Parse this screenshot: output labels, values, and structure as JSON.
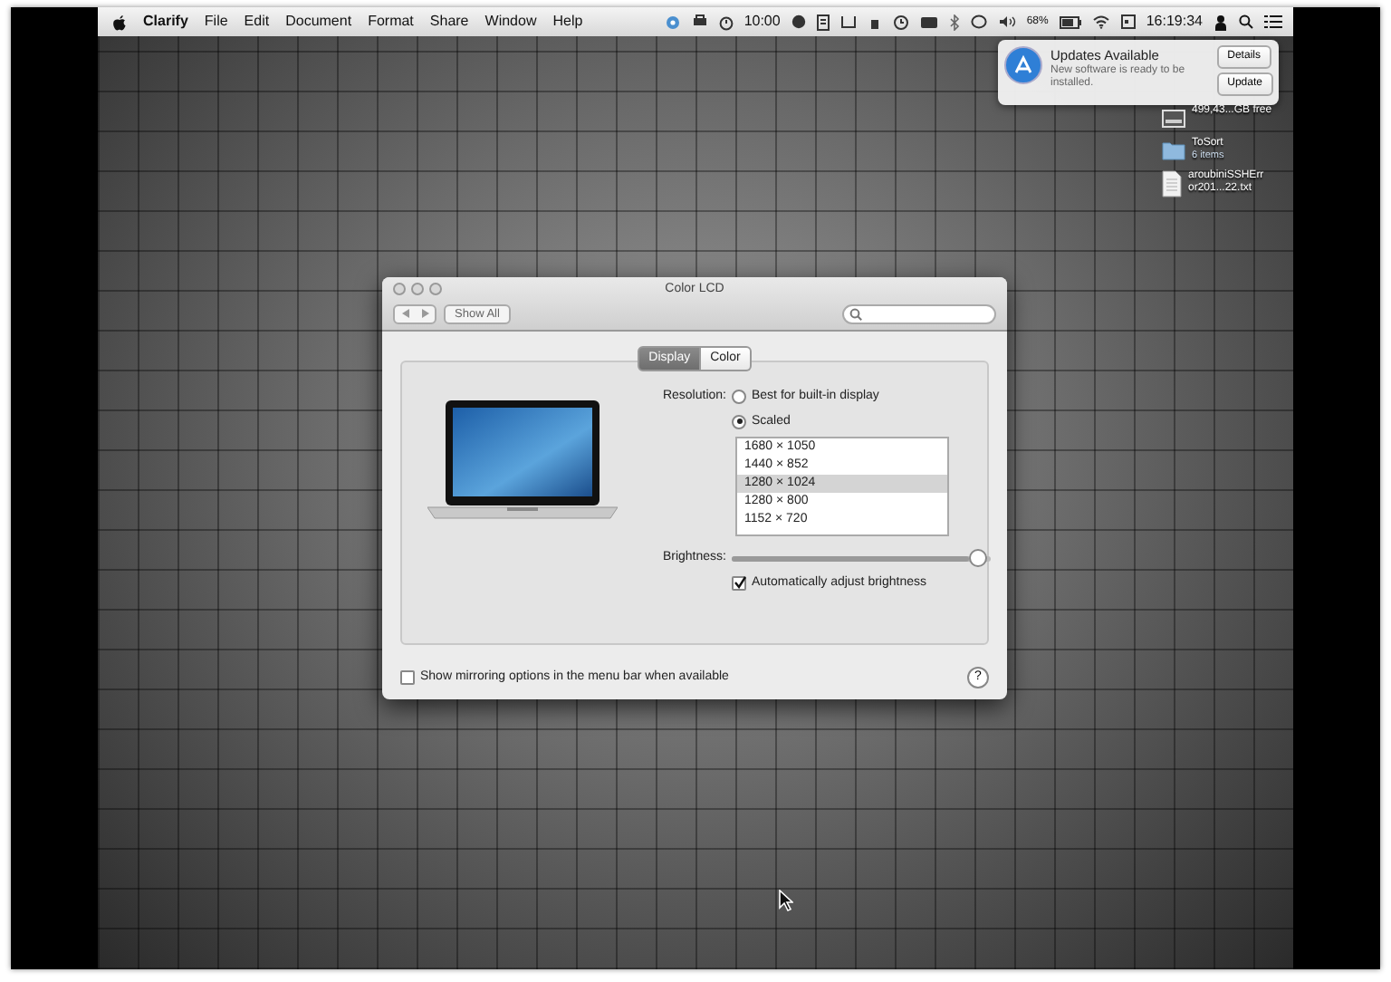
{
  "menu_bar": {
    "app_name": "Clarify",
    "menus": [
      "File",
      "Edit",
      "Document",
      "Format",
      "Share",
      "Window",
      "Help"
    ],
    "clock_text": "10:00",
    "battery_percent": "68%",
    "time": "16:19:34"
  },
  "notification": {
    "title": "Updates Available",
    "message": "New software is ready to be installed.",
    "buttons": [
      "Details",
      "Update"
    ]
  },
  "desktop_items": [
    {
      "kind": "drive",
      "label_lines": [
        "499,43...GB free"
      ]
    },
    {
      "kind": "folder",
      "label_lines": [
        "ToSort"
      ],
      "sublabel": "6 items"
    },
    {
      "kind": "file",
      "label_lines": [
        "aroubiniSSHErr",
        "or201...22.txt"
      ]
    }
  ],
  "window": {
    "title": "Color LCD",
    "show_all": "Show All",
    "tabs": [
      {
        "label": "Display",
        "selected": true
      },
      {
        "label": "Color",
        "selected": false
      }
    ],
    "resolution_label": "Resolution:",
    "resolution_options": [
      {
        "label": "Best for built-in display",
        "selected": false
      },
      {
        "label": "Scaled",
        "selected": true
      }
    ],
    "resolutions": [
      {
        "label": "1680 × 1050",
        "selected": false
      },
      {
        "label": "1440 × 852",
        "selected": false
      },
      {
        "label": "1280 × 1024",
        "selected": true
      },
      {
        "label": "1280 × 800",
        "selected": false
      },
      {
        "label": "1152 × 720",
        "selected": false
      }
    ],
    "brightness": {
      "label": "Brightness:",
      "level": 0.95
    },
    "auto_brightness": {
      "label": "Automatically adjust brightness",
      "checked": true
    },
    "mirroring": {
      "label": "Show mirroring options in the menu bar when available",
      "checked": false
    },
    "help": "?"
  }
}
